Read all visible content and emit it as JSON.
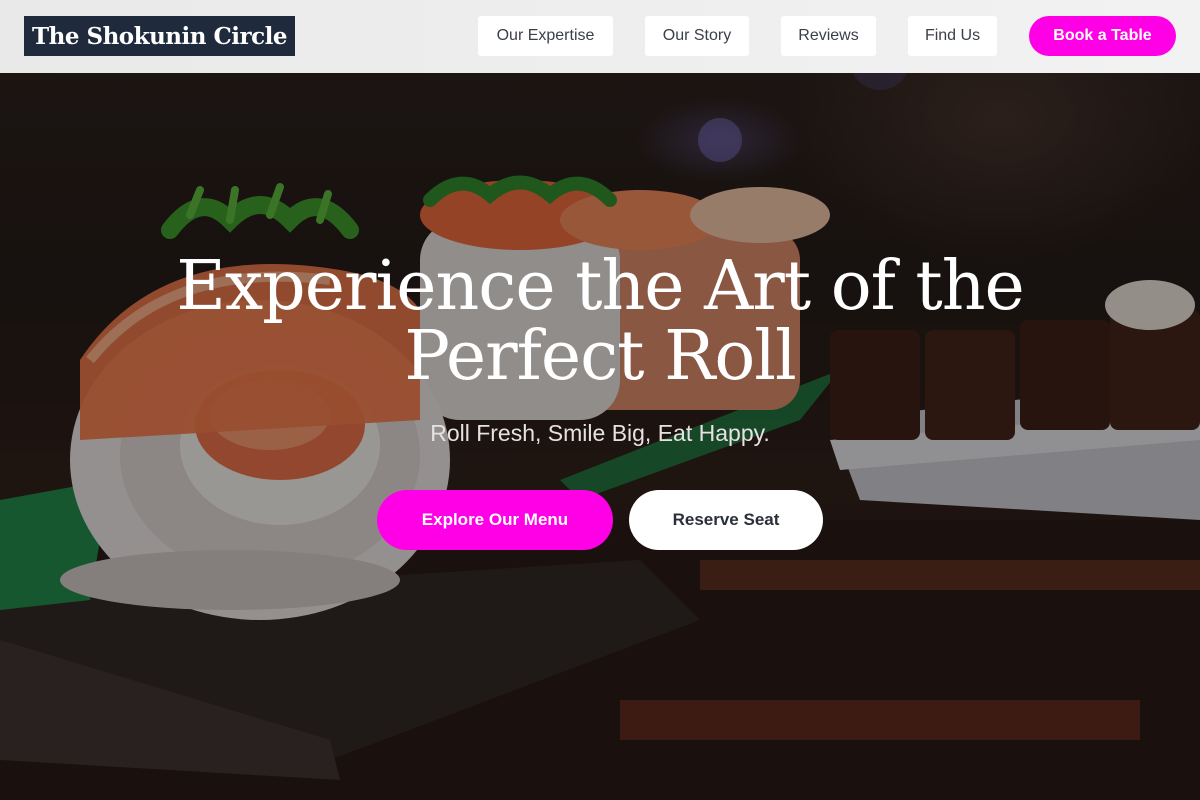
{
  "brand": {
    "name": "The Shokunin Circle"
  },
  "nav": {
    "items": [
      {
        "label": "Our Expertise"
      },
      {
        "label": "Our Story"
      },
      {
        "label": "Reviews"
      },
      {
        "label": "Find Us"
      }
    ],
    "book_label": "Book a Table"
  },
  "hero": {
    "headline_line1": "Experience the Art of the",
    "headline_line2": "Perfect Roll",
    "tagline": "Roll Fresh, Smile Big, Eat Happy.",
    "primary_cta": "Explore Our Menu",
    "secondary_cta": "Reserve Seat",
    "image_icon": "sushi-photo"
  },
  "colors": {
    "accent": "#ff00e6",
    "logo_bg": "#1f2a3d",
    "header_bg": "#eeeeee",
    "text_light": "#ffffff"
  }
}
